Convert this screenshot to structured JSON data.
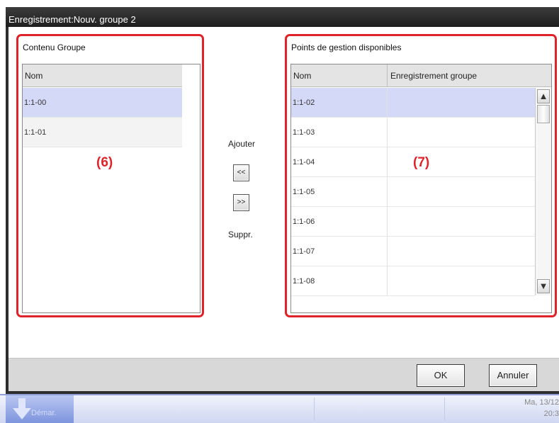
{
  "window": {
    "title": "Enregistrement:Nouv. groupe 2"
  },
  "group_panel": {
    "label": "Contenu Groupe",
    "column_header": "Nom",
    "rows": [
      "1:1-00",
      "1:1-01"
    ],
    "callout": "(6)"
  },
  "transfer": {
    "add_label": "Ajouter",
    "add_button": "<<",
    "remove_button": ">>",
    "remove_label": "Suppr."
  },
  "points_panel": {
    "label": "Points de gestion disponibles",
    "columns": [
      "Nom",
      "Enregistrement groupe"
    ],
    "rows": [
      {
        "name": "1:1-02",
        "group": ""
      },
      {
        "name": "1:1-03",
        "group": ""
      },
      {
        "name": "1:1-04",
        "group": ""
      },
      {
        "name": "1:1-05",
        "group": ""
      },
      {
        "name": "1:1-06",
        "group": ""
      },
      {
        "name": "1:1-07",
        "group": ""
      },
      {
        "name": "1:1-08",
        "group": ""
      }
    ],
    "callout": "(7)",
    "scroll_up_icon": "▲",
    "scroll_down_icon": "▼"
  },
  "buttons": {
    "ok": "OK",
    "cancel": "Annuler"
  },
  "taskbar": {
    "start_label": "Démar.",
    "date": "Ma, 13/12",
    "time": "20:3"
  },
  "colors": {
    "highlight_frame": "#e0232a",
    "selected_row": "#d5d9f8"
  }
}
